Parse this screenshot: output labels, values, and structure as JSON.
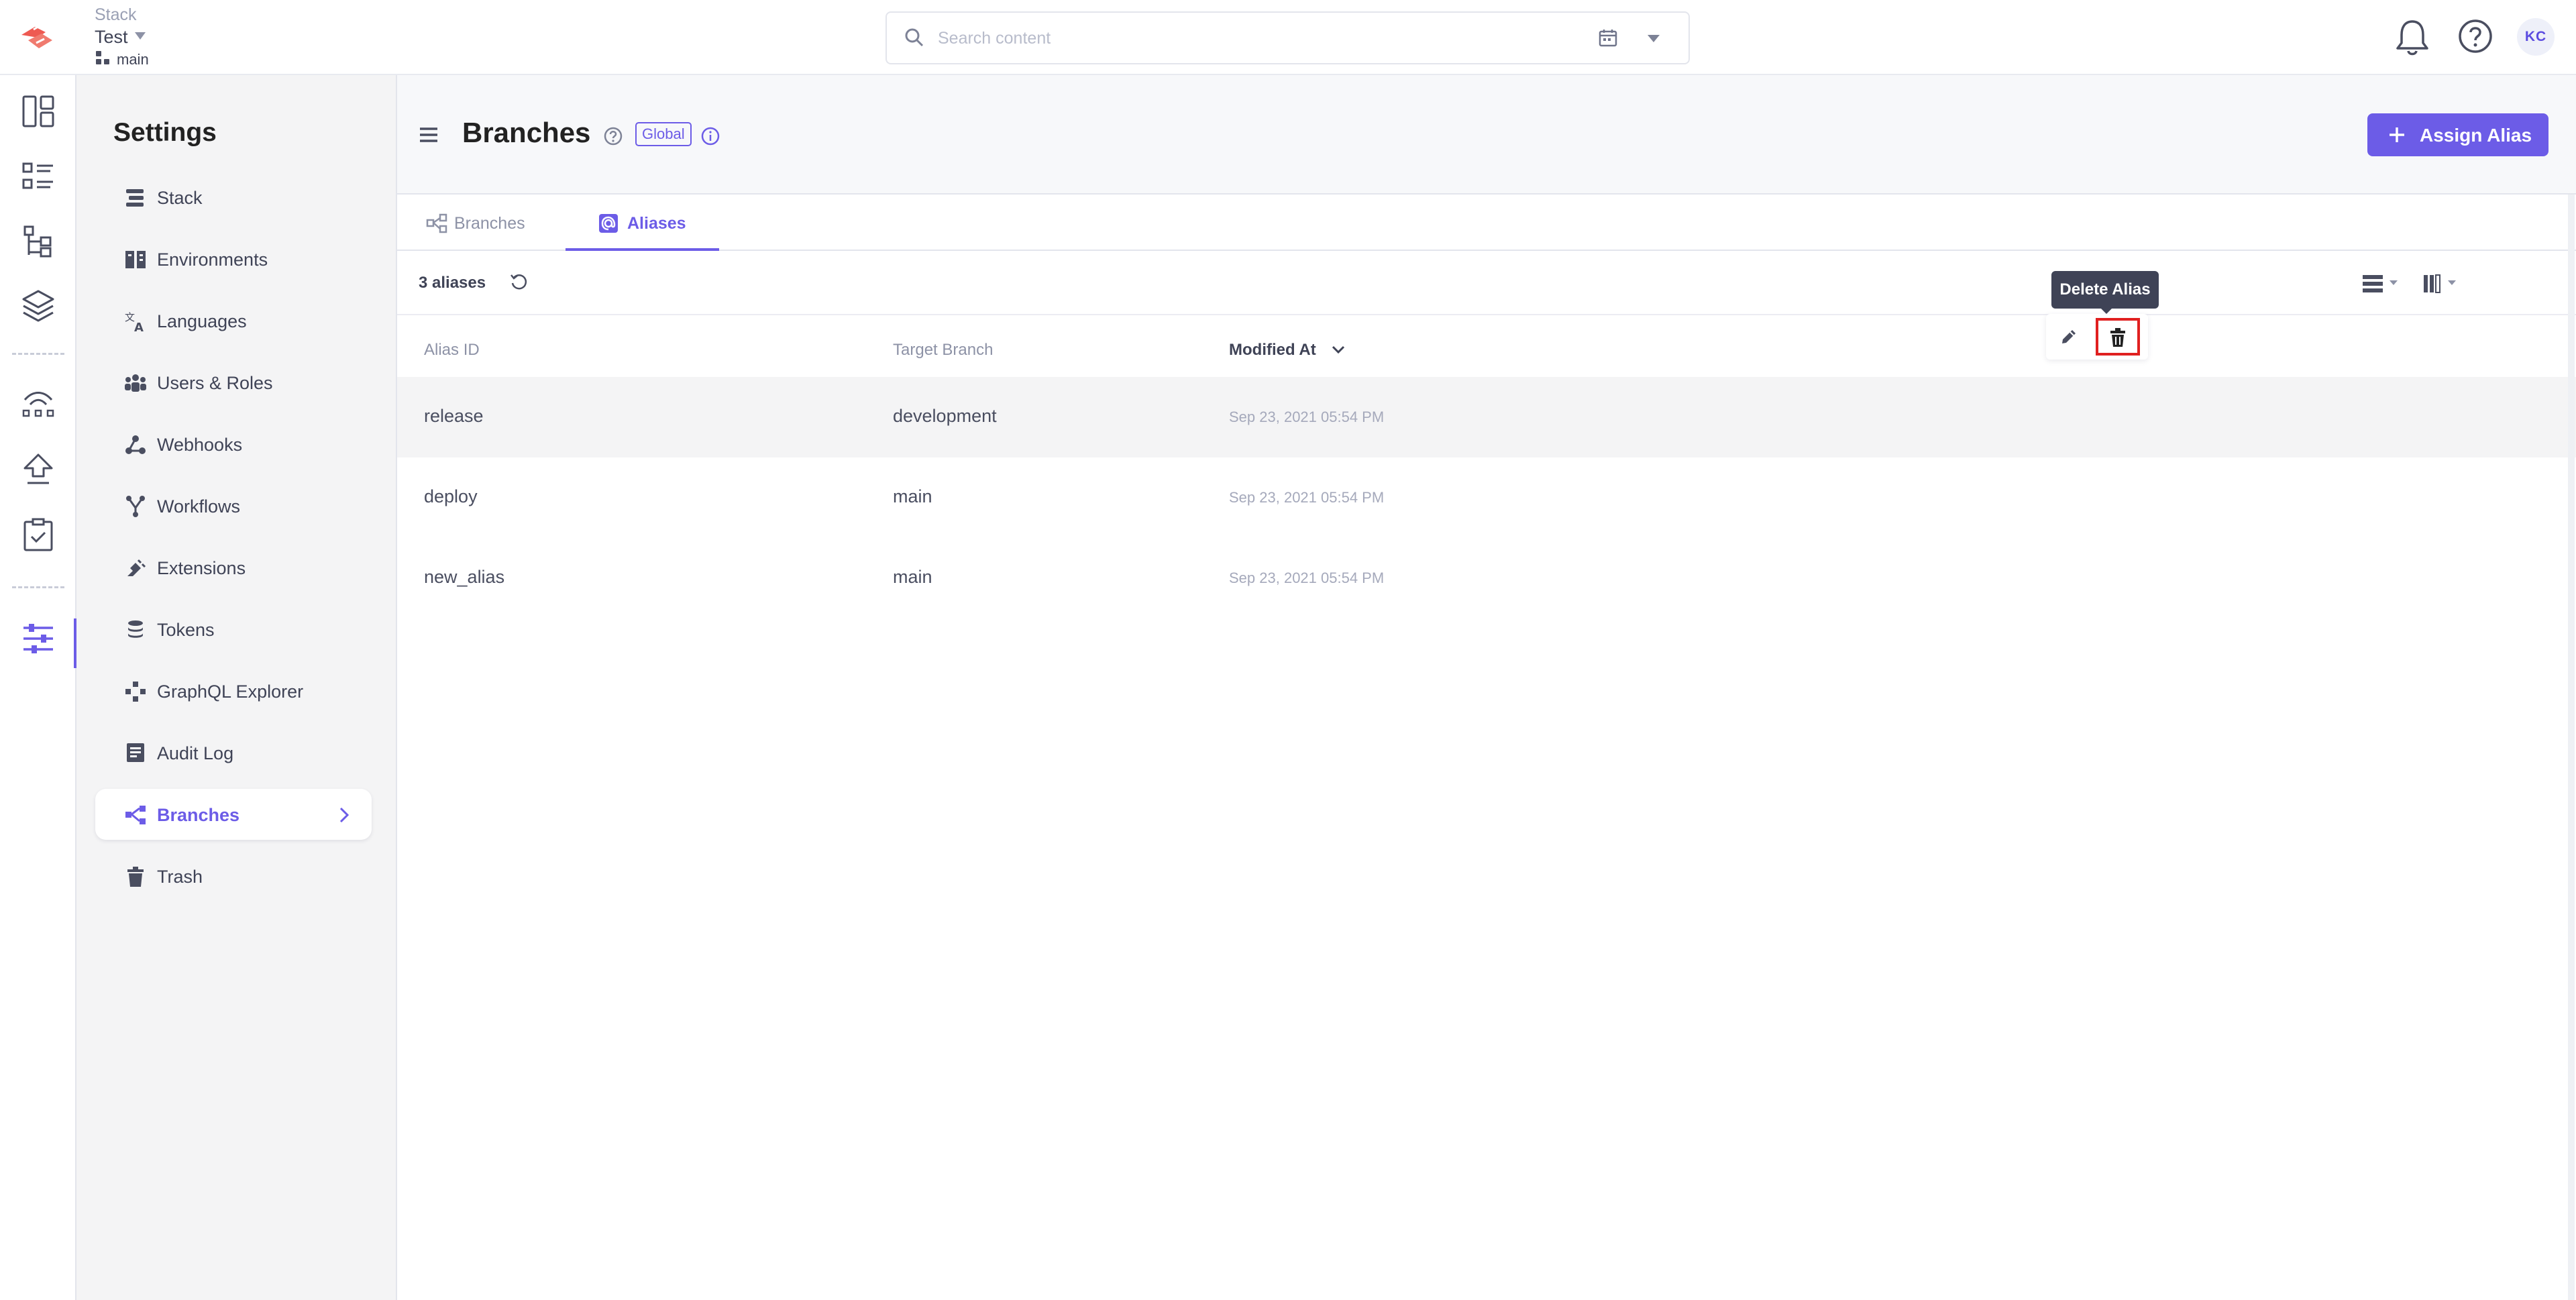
{
  "header": {
    "stack_label": "Stack",
    "stack_name": "Test",
    "branch": "main",
    "search_placeholder": "Search content",
    "avatar_initials": "KC",
    "icons": [
      "logo-icon",
      "branch-icon",
      "search-icon",
      "calendar-icon",
      "bell-icon",
      "help-icon"
    ]
  },
  "rail": {
    "icons": [
      "dashboard-icon",
      "content-list-icon",
      "content-models-icon",
      "assets-icon",
      "deployments-icon",
      "publish-queue-icon",
      "tasks-icon",
      "settings-icon"
    ],
    "active": "settings-icon"
  },
  "settings": {
    "title": "Settings",
    "items": [
      {
        "label": "Stack",
        "icon": "stack-icon"
      },
      {
        "label": "Environments",
        "icon": "environments-icon"
      },
      {
        "label": "Languages",
        "icon": "languages-icon"
      },
      {
        "label": "Users & Roles",
        "icon": "users-icon"
      },
      {
        "label": "Webhooks",
        "icon": "webhooks-icon"
      },
      {
        "label": "Workflows",
        "icon": "workflows-icon"
      },
      {
        "label": "Extensions",
        "icon": "extensions-icon"
      },
      {
        "label": "Tokens",
        "icon": "tokens-icon"
      },
      {
        "label": "GraphQL Explorer",
        "icon": "graphql-icon"
      },
      {
        "label": "Audit Log",
        "icon": "audit-log-icon"
      },
      {
        "label": "Branches",
        "icon": "branches-icon",
        "active": true
      },
      {
        "label": "Trash",
        "icon": "trash-icon"
      }
    ]
  },
  "page": {
    "title": "Branches",
    "badge": "Global",
    "assign_button": "Assign Alias",
    "tabs": [
      {
        "label": "Branches",
        "active": false
      },
      {
        "label": "Aliases",
        "active": true
      }
    ],
    "count_text": "3 aliases"
  },
  "table": {
    "columns": [
      "Alias ID",
      "Target Branch",
      "Modified At"
    ],
    "sorted_column": "Modified At",
    "rows": [
      {
        "alias": "release",
        "target": "development",
        "modified": "Sep 23, 2021 05:54 PM"
      },
      {
        "alias": "deploy",
        "target": "main",
        "modified": "Sep 23, 2021 05:54 PM"
      },
      {
        "alias": "new_alias",
        "target": "main",
        "modified": "Sep 23, 2021 05:54 PM"
      }
    ],
    "tooltip": "Delete Alias"
  },
  "colors": {
    "accent": "#6c5ce7",
    "logo": "#ee5a52",
    "highlight_border": "#e02020"
  }
}
